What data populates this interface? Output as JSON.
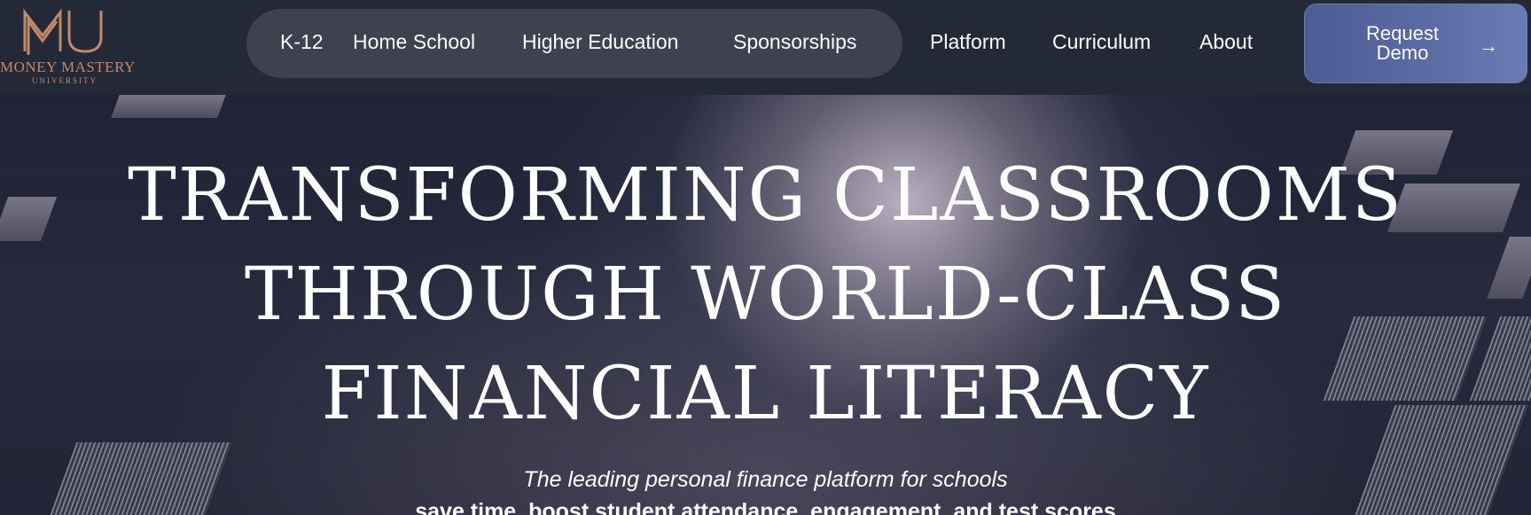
{
  "brand": {
    "name": "MONEY MASTERY",
    "sub": "UNIVERSITY",
    "logo_color": "#c08a6a"
  },
  "nav": {
    "pill_items": [
      {
        "label": "K-12"
      },
      {
        "label": "Home School"
      },
      {
        "label": "Higher Education"
      },
      {
        "label": "Sponsorships"
      }
    ],
    "items": [
      {
        "label": "Platform"
      },
      {
        "label": "Curriculum"
      },
      {
        "label": "About"
      }
    ],
    "cta": {
      "label": "Request Demo",
      "icon": "arrow-right-icon"
    }
  },
  "hero": {
    "headline_lines": [
      "TRANSFORMING CLASSROOMS",
      "THROUGH WORLD-CLASS",
      "FINANCIAL LITERACY"
    ],
    "subtitle": "The leading personal finance platform for schools",
    "tagline": "save time, boost student attendance, engagement, and test scores"
  },
  "colors": {
    "header_bg": "#242938",
    "pill_bg": "#3d4150",
    "cta_bg": "#5c6da6"
  }
}
